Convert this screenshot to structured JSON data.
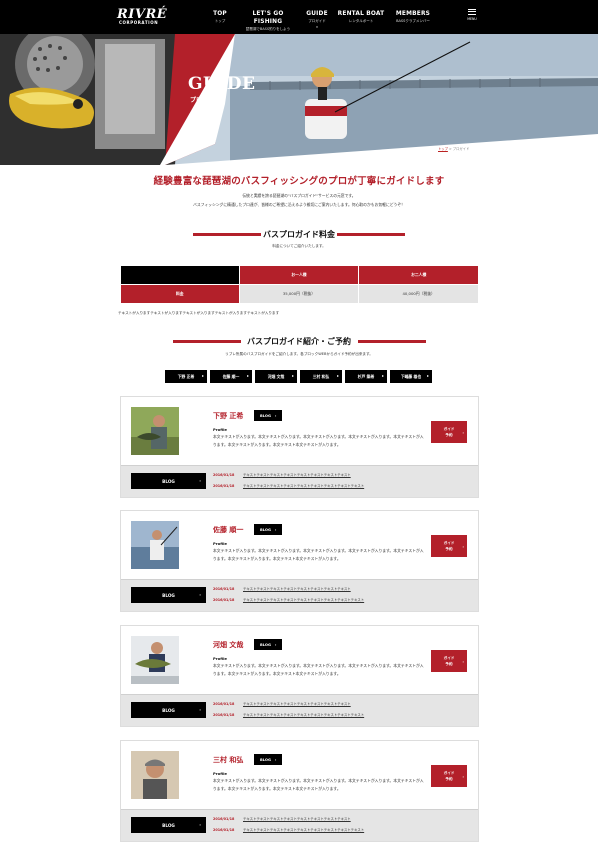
{
  "header": {
    "logo": "RIVRÉ",
    "logo_sub": "CORPORATION",
    "nav": [
      {
        "en": "TOP",
        "jp": "トップ"
      },
      {
        "en": "LET'S GO FISHING",
        "jp": "琵琶湖でBASS釣りをしよう"
      },
      {
        "en": "GUIDE",
        "jp": "プロガイド"
      },
      {
        "en": "RENTAL BOAT",
        "jp": "レンタルボート"
      },
      {
        "en": "MEMBERS",
        "jp": "BASSクラブメンバー"
      }
    ],
    "menu_label": "MENU"
  },
  "hero": {
    "title": "GUIDE",
    "subtitle": "プロガイド"
  },
  "breadcrumb": {
    "home": "トップ",
    "sep": ">",
    "current": "プロガイド"
  },
  "lead": {
    "title": "経験豊富な琵琶湖のバスフィッシングのプロが丁寧にガイドします",
    "p1": "伝統と実績を誇る琵琶湖の\"バスプロガイド\"サービスの元窓です。",
    "p2": "バスフィッシングに精通したプロ達が、皆様のご希望に沿えるよう親切にご案内いたします。何心取のかもお気軽にどうぞ！"
  },
  "price": {
    "heading": "バスプロガイド料金",
    "sub": "料金についてご紹介いたします。",
    "col1": "お一人様",
    "col2": "お二人様",
    "row_label": "料金",
    "v1": "35,000円（税抜）",
    "v2": "40,000円（税抜）",
    "note": "テキストが入りますテキストが入りますテキストが入りますテキストが入りますテキストが入ります"
  },
  "guides_section": {
    "heading": "バスプロガイド紹介・ご予約",
    "sub": "リブレ所属のバスプロガイドをご紹介します。各ブロックWEBからガイド予約が出来ます。",
    "tabs": [
      "下野 正希",
      "佐藤 順一",
      "河畑 文哉",
      "三村 和弘",
      "杉戸 築希",
      "下嶋藤 雄也"
    ]
  },
  "cards": [
    {
      "name": "下野 正希",
      "blog_tag": "BLOG",
      "profile_label": "Profile",
      "profile": "本文テキストが入ります。本文テキストが入ります。本文テキストが入ります。本文テキストが入ります。本文テキストが入ります。本文テキストが入ります。本文テキスト本文テキストが入ります。",
      "guide_btn": [
        "ガイド",
        "予約"
      ],
      "blog_btn": "BLOG",
      "entries": [
        {
          "date": "2016/01/18",
          "title": "テキストテキストテキストテキストテキストテキストテキストテキスト"
        },
        {
          "date": "2016/01/18",
          "title": "テキストテキストテキストテキストテキストテキストテキストテキストテキスト"
        }
      ]
    },
    {
      "name": "佐藤 順一",
      "blog_tag": "BLOG",
      "profile_label": "Profile",
      "profile": "本文テキストが入ります。本文テキストが入ります。本文テキストが入ります。本文テキストが入ります。本文テキストが入ります。本文テキストが入ります。本文テキスト本文テキストが入ります。",
      "guide_btn": [
        "ガイド",
        "予約"
      ],
      "blog_btn": "BLOG",
      "entries": [
        {
          "date": "2016/01/18",
          "title": "テキストテキストテキストテキストテキストテキストテキストテキスト"
        },
        {
          "date": "2016/01/18",
          "title": "テキストテキストテキストテキストテキストテキストテキストテキストテキスト"
        }
      ]
    },
    {
      "name": "河畑 文哉",
      "blog_tag": "BLOG",
      "profile_label": "Profile",
      "profile": "本文テキストが入ります。本文テキストが入ります。本文テキストが入ります。本文テキストが入ります。本文テキストが入ります。本文テキストが入ります。本文テキスト本文テキストが入ります。",
      "guide_btn": [
        "ガイド",
        "予約"
      ],
      "blog_btn": "BLOG",
      "entries": [
        {
          "date": "2016/01/18",
          "title": "テキストテキストテキストテキストテキストテキストテキストテキスト"
        },
        {
          "date": "2016/01/18",
          "title": "テキストテキストテキストテキストテキストテキストテキストテキストテキスト"
        }
      ]
    },
    {
      "name": "三村 和弘",
      "blog_tag": "BLOG",
      "profile_label": "Profile",
      "profile": "本文テキストが入ります。本文テキストが入ります。本文テキストが入ります。本文テキストが入ります。本文テキストが入ります。本文テキストが入ります。本文テキスト本文テキストが入ります。",
      "guide_btn": [
        "ガイド",
        "予約"
      ],
      "blog_btn": "BLOG",
      "entries": [
        {
          "date": "2016/01/18",
          "title": "テキストテキストテキストテキストテキストテキストテキストテキスト"
        },
        {
          "date": "2016/01/18",
          "title": "テキストテキストテキストテキストテキストテキストテキストテキストテキスト"
        }
      ]
    }
  ],
  "colors": {
    "accent": "#b3202a",
    "header": "#000000",
    "table_grey": "#e4e4e4"
  }
}
